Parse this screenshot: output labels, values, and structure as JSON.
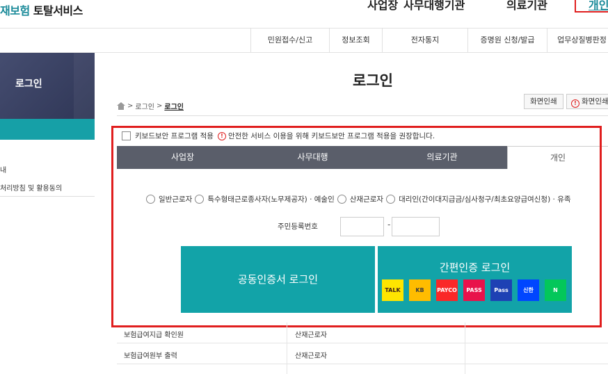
{
  "header": {
    "brand_part1": "재보험",
    "brand_part2": "토탈서비스",
    "nav": [
      "사업장",
      "사무대행기관",
      "의료기관"
    ],
    "personal_link": "개인"
  },
  "subnav": [
    "민원접수/신고",
    "정보조회",
    "전자통지",
    "증명원 신청/발급",
    "업무상질병판정"
  ],
  "sidebar": {
    "title": "로그인",
    "items": [
      "내",
      "처리방침 및 활용동의"
    ]
  },
  "main": {
    "title": "로그인",
    "breadcrumb": [
      "로그인",
      "로그인"
    ],
    "print_label": "화면인쇄",
    "print_help_label": "화면인쇄"
  },
  "keyboard_security": {
    "label": "키보드보안 프로그램 적용",
    "notice": "안전한 서비스 이용을 위해 키보드보안 프로그램 적용을 권장합니다."
  },
  "tabs": [
    "사업장",
    "사무대행",
    "의료기관",
    "개인"
  ],
  "radios": [
    "일반근로자",
    "특수형태근로종사자(노무제공자) · 예술인",
    "산재근로자",
    "대리인(간이대지급금/심사청구/최초요양급여신청) · 유족"
  ],
  "rrn": {
    "label": "주민등록번호",
    "dash": "-"
  },
  "buttons": {
    "cert_login": "공동인증서 로그인",
    "simple_login": "간편인증 로그인"
  },
  "auth_providers": [
    {
      "label": "TALK",
      "bg": "#fee500",
      "fg": "#3a1d1d"
    },
    {
      "label": "KB",
      "bg": "#ffbc00",
      "fg": "#3c3c3c"
    },
    {
      "label": "PAYCO",
      "bg": "#fa2828",
      "fg": "#ffffff"
    },
    {
      "label": "PASS",
      "bg": "#e8134b",
      "fg": "#ffffff"
    },
    {
      "label": "Pass",
      "bg": "#1e41b4",
      "fg": "#ffffff"
    },
    {
      "label": "신한",
      "bg": "#0046ff",
      "fg": "#ffffff"
    },
    {
      "label": "N",
      "bg": "#03c75a",
      "fg": "#ffffff"
    }
  ],
  "table": [
    {
      "name": "보험급여지급 확인원",
      "target": "산재근로자"
    },
    {
      "name": "보험급여원부 출력",
      "target": "산재근로자"
    },
    {
      "name": "",
      "target": ""
    }
  ],
  "colors": {
    "accent": "#12a3a8",
    "highlight_red": "#e01e1e",
    "tab_dark": "#5a5e6a"
  }
}
